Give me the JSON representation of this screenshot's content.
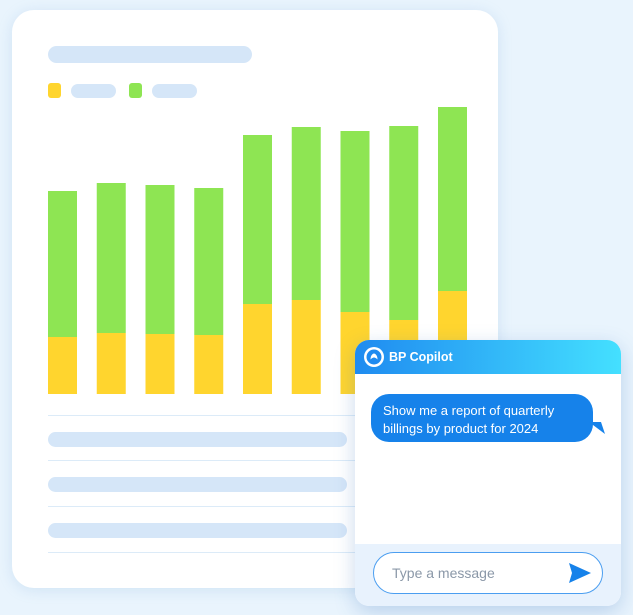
{
  "chart_data": {
    "type": "bar",
    "stacked": true,
    "categories": [
      "",
      "",
      "",
      "",
      "",
      "",
      "",
      "",
      ""
    ],
    "series": [
      {
        "color": "#ffd52e",
        "values": [
          57,
          61,
          60,
          59,
          90,
          94,
          82,
          74,
          103
        ]
      },
      {
        "color": "#8ee553",
        "values": [
          146,
          150,
          149,
          147,
          169,
          173,
          181,
          194,
          184
        ]
      }
    ],
    "ylim": [
      0,
      290
    ],
    "grid": false,
    "legend": "top-left"
  },
  "colors": {
    "placeholder": "#d5e6f8",
    "accent": "#1682ea",
    "background": "#e9f4fd"
  },
  "chat": {
    "title": "BP Copilot",
    "logo_icon": "bp-copilot-logo-icon",
    "message": "Show me a report of quarterly billings by product for 2024",
    "input_placeholder": "Type a message",
    "send_icon": "send-icon"
  }
}
